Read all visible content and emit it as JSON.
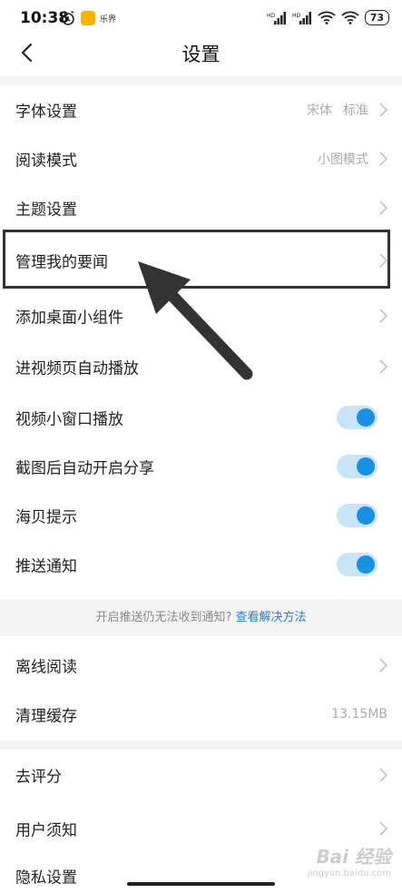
{
  "status_bar": {
    "time": "10:38",
    "notification_badge": "乐界",
    "battery": "73"
  },
  "header": {
    "title": "设置"
  },
  "rows": [
    {
      "label": "字体设置",
      "value_1": "宋体",
      "value_2": "标准"
    },
    {
      "label": "阅读模式",
      "value_1": "小图模式"
    },
    {
      "label": "主题设置"
    },
    {
      "label": "管理我的要闻"
    },
    {
      "label": "添加桌面小组件"
    },
    {
      "label": "进视频页自动播放"
    },
    {
      "label": "视频小窗口播放",
      "toggle_on": true
    },
    {
      "label": "截图后自动开启分享",
      "toggle_on": true
    },
    {
      "label": "海贝提示",
      "toggle_on": true
    },
    {
      "label": "推送通知",
      "toggle_on": true
    }
  ],
  "hint": {
    "text": "开启推送仍无法收到通知?",
    "link": "查看解决方法"
  },
  "rows_2": [
    {
      "label": "离线阅读"
    },
    {
      "label": "清理缓存",
      "value_1": "13.15MB"
    }
  ],
  "rows_3": [
    {
      "label": "去评分"
    },
    {
      "label": "用户须知"
    },
    {
      "label": "隐私设置"
    }
  ],
  "watermark": {
    "main": "Bai 经验",
    "sub": "jingyan.baidu.com"
  },
  "colors": {
    "accent": "#1a90e2",
    "toggle_track": "#c8e4f6",
    "divider": "#f4f4f4"
  }
}
